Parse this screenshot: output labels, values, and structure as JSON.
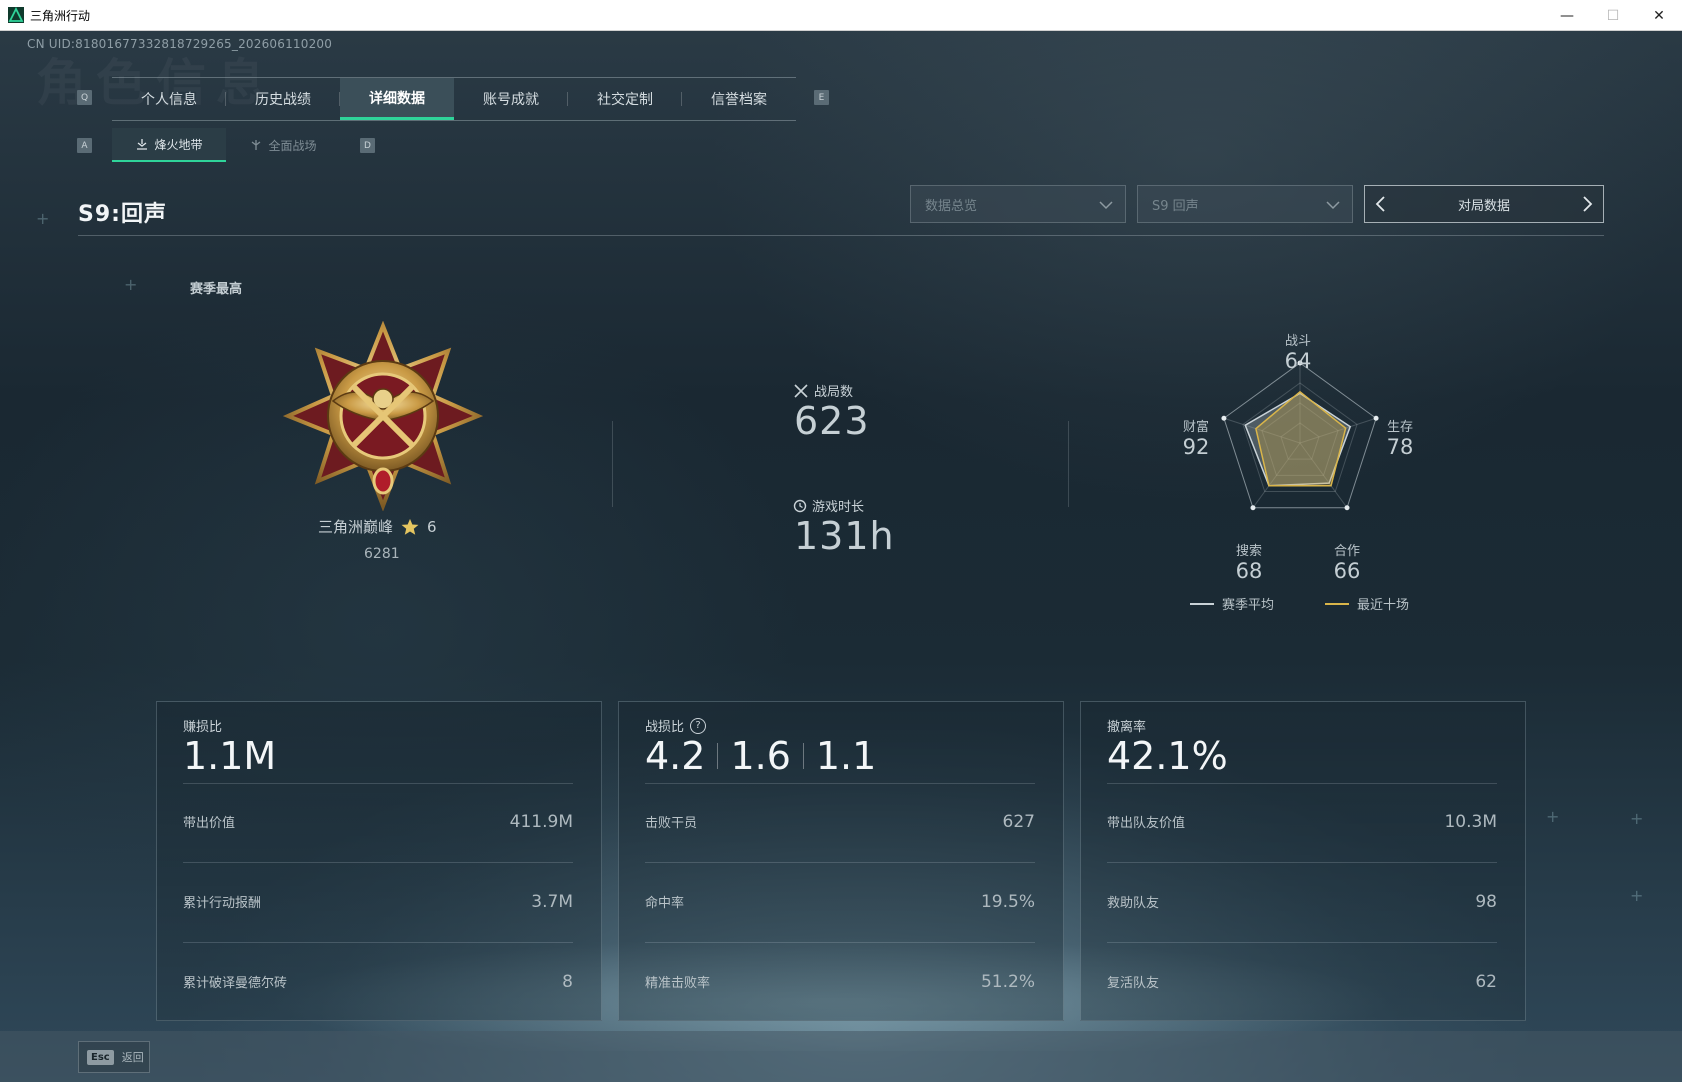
{
  "window": {
    "title": "三角洲行动",
    "controls": {
      "minimize": "—",
      "maximize": "☐",
      "close": "✕"
    }
  },
  "uid": "CN UID:8180167733281872926​5_202606110200",
  "nav": {
    "left_key": "Q",
    "right_key": "E",
    "tabs": [
      {
        "label": "个人信息",
        "active": false
      },
      {
        "label": "历史战绩",
        "active": false
      },
      {
        "label": "详细数据",
        "active": true
      },
      {
        "label": "账号成就",
        "active": false
      },
      {
        "label": "社交定制",
        "active": false
      },
      {
        "label": "信誉档案",
        "active": false
      }
    ]
  },
  "subnav": {
    "left_key": "A",
    "right_key": "D",
    "tabs": [
      {
        "label": "烽火地带",
        "icon": "extraction-icon",
        "active": true
      },
      {
        "label": "全面战场",
        "icon": "warfare-icon",
        "active": false
      }
    ]
  },
  "season": {
    "title": "S9:回声"
  },
  "filters": {
    "data_type": "数据总览",
    "season_select": "S9 回声",
    "match_nav_label": "对局数据"
  },
  "rank": {
    "section_label": "赛季最高",
    "name": "三角洲巅峰",
    "stars": "6",
    "score": "6281"
  },
  "summary": {
    "matches_label": "战局数",
    "matches_value": "623",
    "playtime_label": "游戏时长",
    "playtime_value": "131h"
  },
  "radar": {
    "axes": [
      {
        "label": "战斗",
        "value": "64"
      },
      {
        "label": "生存",
        "value": "78"
      },
      {
        "label": "合作",
        "value": "66"
      },
      {
        "label": "搜索",
        "value": "68"
      },
      {
        "label": "财富",
        "value": "92"
      }
    ],
    "season_avg": [
      0.62,
      0.66,
      0.62,
      0.66,
      0.72
    ],
    "recent_ten": [
      0.64,
      0.6,
      0.66,
      0.66,
      0.58
    ],
    "legend": {
      "season_avg": "赛季平均",
      "recent_ten": "最近十场"
    },
    "colors": {
      "season_avg": "#c9d2d7",
      "recent_ten": "#d9b54a"
    }
  },
  "cards": [
    {
      "title": "赚损比",
      "big": [
        "1.1M"
      ],
      "rows": [
        {
          "label": "带出价值",
          "value": "411.9M"
        },
        {
          "label": "累计行动报酬",
          "value": "3.7M"
        },
        {
          "label": "累计破译曼德尔砖",
          "value": "8"
        }
      ]
    },
    {
      "title": "战损比",
      "help": "?",
      "big": [
        "4.2",
        "1.6",
        "1.1"
      ],
      "rows": [
        {
          "label": "击败干员",
          "value": "627"
        },
        {
          "label": "命中率",
          "value": "19.5%"
        },
        {
          "label": "精准击败率",
          "value": "51.2%"
        }
      ]
    },
    {
      "title": "撤离率",
      "big": [
        "42.1%"
      ],
      "rows": [
        {
          "label": "带出队友价值",
          "value": "10.3M"
        },
        {
          "label": "救助队友",
          "value": "98"
        },
        {
          "label": "复活队友",
          "value": "62"
        }
      ]
    }
  ],
  "footer": {
    "key": "Esc",
    "label": "返回"
  }
}
